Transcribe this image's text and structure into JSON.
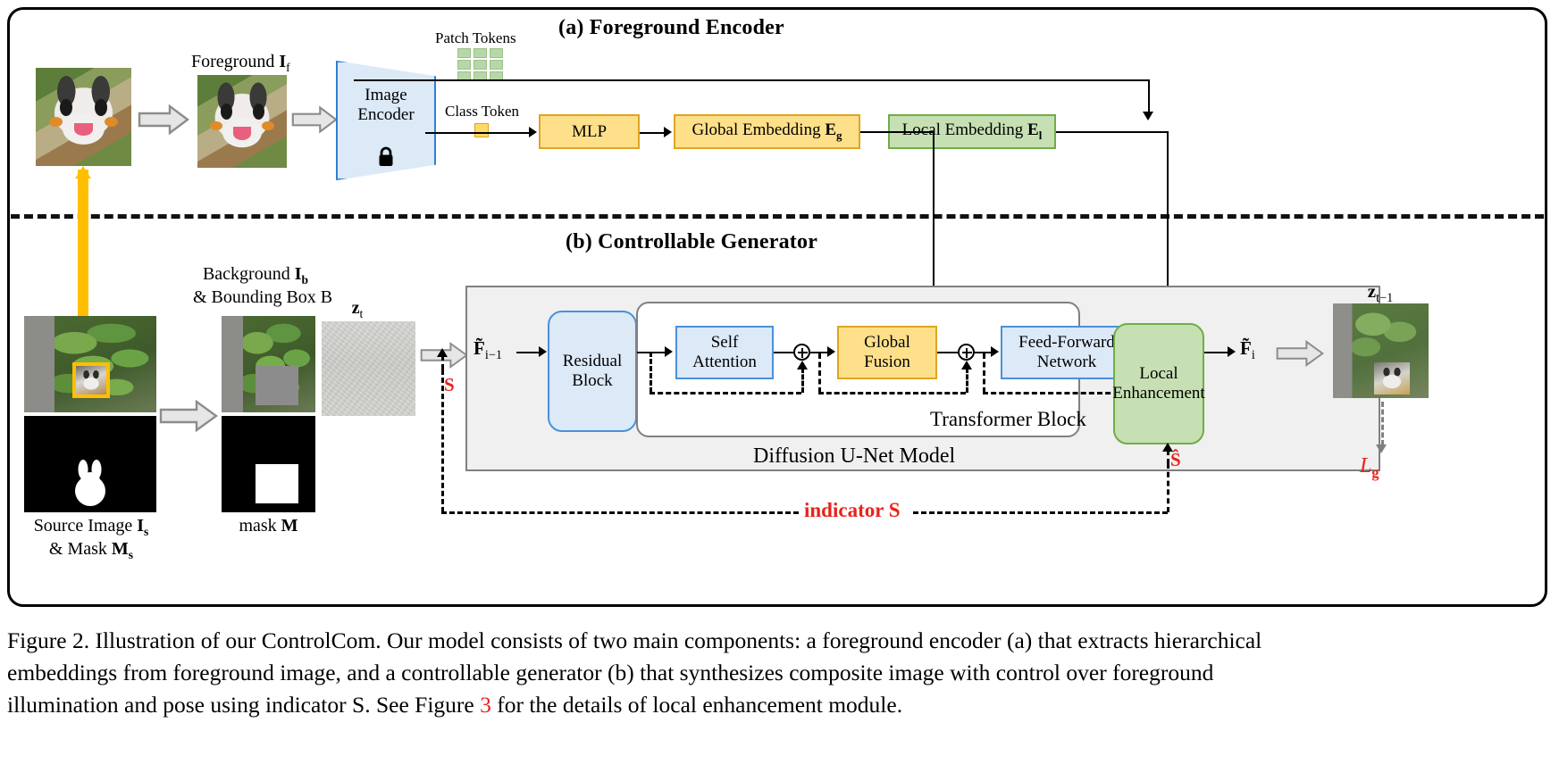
{
  "figure": {
    "section_a_title": "(a) Foreground Encoder",
    "section_b_title": "(b) Controllable Generator"
  },
  "encoder_panel": {
    "foreground_label_main": "Foreground",
    "foreground_label_sym": "I",
    "foreground_label_sub": "f",
    "image_encoder_line1": "Image",
    "image_encoder_line2": "Encoder",
    "lock_icon": "lock-icon",
    "patch_tokens_label": "Patch Tokens",
    "class_token_label": "Class Token",
    "mlp_label": "MLP",
    "global_embedding_label": "Global Embedding",
    "global_embedding_sym": "E",
    "global_embedding_sub": "g",
    "local_embedding_label": "Local Embedding",
    "local_embedding_sym": "E",
    "local_embedding_sub": "l"
  },
  "generator_panel": {
    "source_image_line1_pre": "Source Image",
    "source_image_line1_sym": "I",
    "source_image_line1_sub": "s",
    "source_image_line2_pre": "& Mask",
    "source_image_line2_sym": "M",
    "source_image_line2_sub": "s",
    "background_line1_pre": "Background",
    "background_line1_sym": "I",
    "background_line1_sub": "b",
    "background_line2_pre": "& Bounding Box",
    "background_line2_sym": "B",
    "mask_label_pre": "mask",
    "mask_label_sym": "M",
    "zt_sym": "z",
    "zt_sub": "t",
    "zt_prev_sym": "z",
    "zt_prev_sub": "t−1",
    "input_feat_sym": "F̃",
    "input_feat_sub": "i−1",
    "mid_feat_sym": "F",
    "mid_feat_sub": "i",
    "out_feat_sym": "F̃",
    "out_feat_sub": "i",
    "residual_block_l1": "Residual",
    "residual_block_l2": "Block",
    "self_attention_l1": "Self",
    "self_attention_l2": "Attention",
    "global_fusion_l1": "Global",
    "global_fusion_l2": "Fusion",
    "ffn_l1": "Feed-Forward",
    "ffn_l2": "Network",
    "local_enhancement_l1": "Local",
    "local_enhancement_l2": "Enhancement",
    "transformer_block_label": "Transformer Block",
    "unet_label": "Diffusion U-Net Model",
    "indicator_s_in": "S",
    "indicator_s_hat": "Ŝ",
    "indicator_label_pre": "indicator",
    "indicator_label_sym": "S",
    "loss_label_pre": "L",
    "loss_label_sub": "g"
  },
  "caption": {
    "line1": "Figure 2. Illustration of our ControlCom. Our model consists of two main components: a foreground encoder (a) that extracts hierarchical",
    "line2": "embeddings from foreground image, and a controllable generator (b) that synthesizes composite image with control over foreground",
    "line3_a": "illumination and pose using indicator ",
    "line3_b": "S",
    "line3_c": ". See Figure ",
    "line3_red": "3",
    "line3_d": " for the details of local enhancement module."
  },
  "colors": {
    "yellow_fill": "#ffe08a",
    "yellow_stroke": "#e0a520",
    "green_fill": "#c6e0b4",
    "green_stroke": "#70ad47",
    "blue_fill": "#dce9f7",
    "blue_stroke": "#4a90d9",
    "grey_fill": "#f0f0f0",
    "grey_stroke": "#808080",
    "red_accent": "#e8231a",
    "gold_accent": "#ffbf00"
  }
}
